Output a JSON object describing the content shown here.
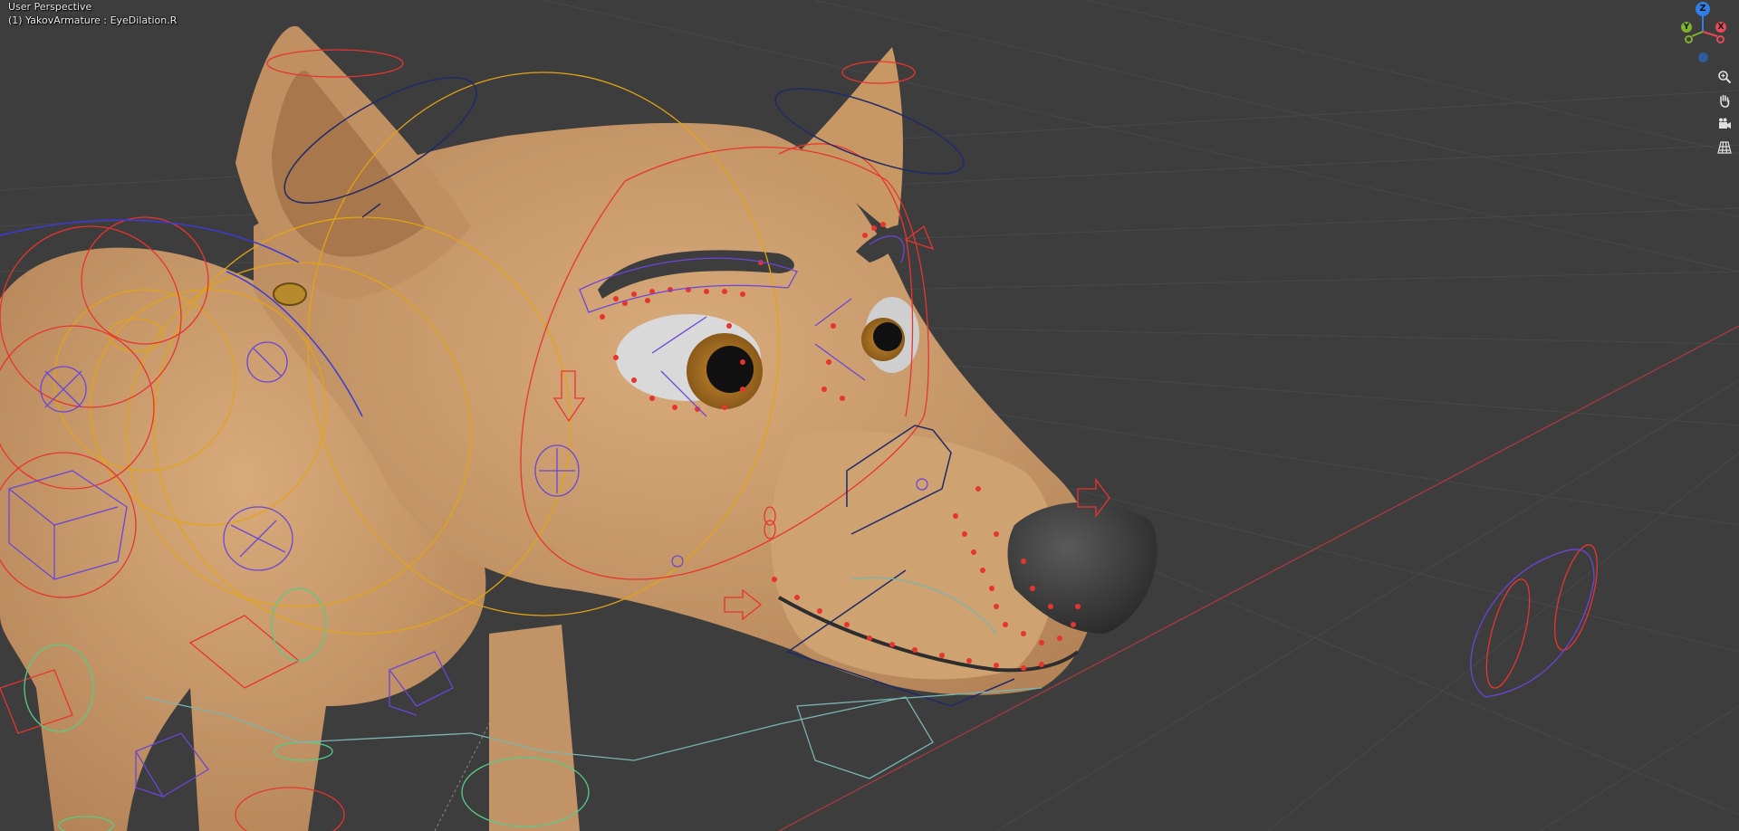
{
  "viewport": {
    "view_name": "User Perspective",
    "object_label": "(1) YakovArmature : EyeDilation.R"
  },
  "gizmo": {
    "axes": [
      {
        "label": "Z",
        "color": "#2f7fe8"
      },
      {
        "label": "Y",
        "color": "#7fb32b"
      },
      {
        "label": "X",
        "color": "#e64a5a"
      }
    ]
  },
  "nav_buttons": [
    {
      "icon": "zoom-icon"
    },
    {
      "icon": "hand-pan-icon"
    },
    {
      "icon": "camera-icon"
    },
    {
      "icon": "grid-perspective-icon"
    }
  ],
  "colors": {
    "background": "#3d3d3d",
    "grid": "#4a4a4a",
    "fur": "#c89a6c",
    "nose": "#3a3a3a",
    "bone_red": "#e8342f",
    "bone_yellow": "#e2a414",
    "bone_purple": "#6b46d6",
    "bone_green": "#55cc88",
    "bone_navy": "#1f2a66",
    "x_axis_line": "#b03a40"
  }
}
